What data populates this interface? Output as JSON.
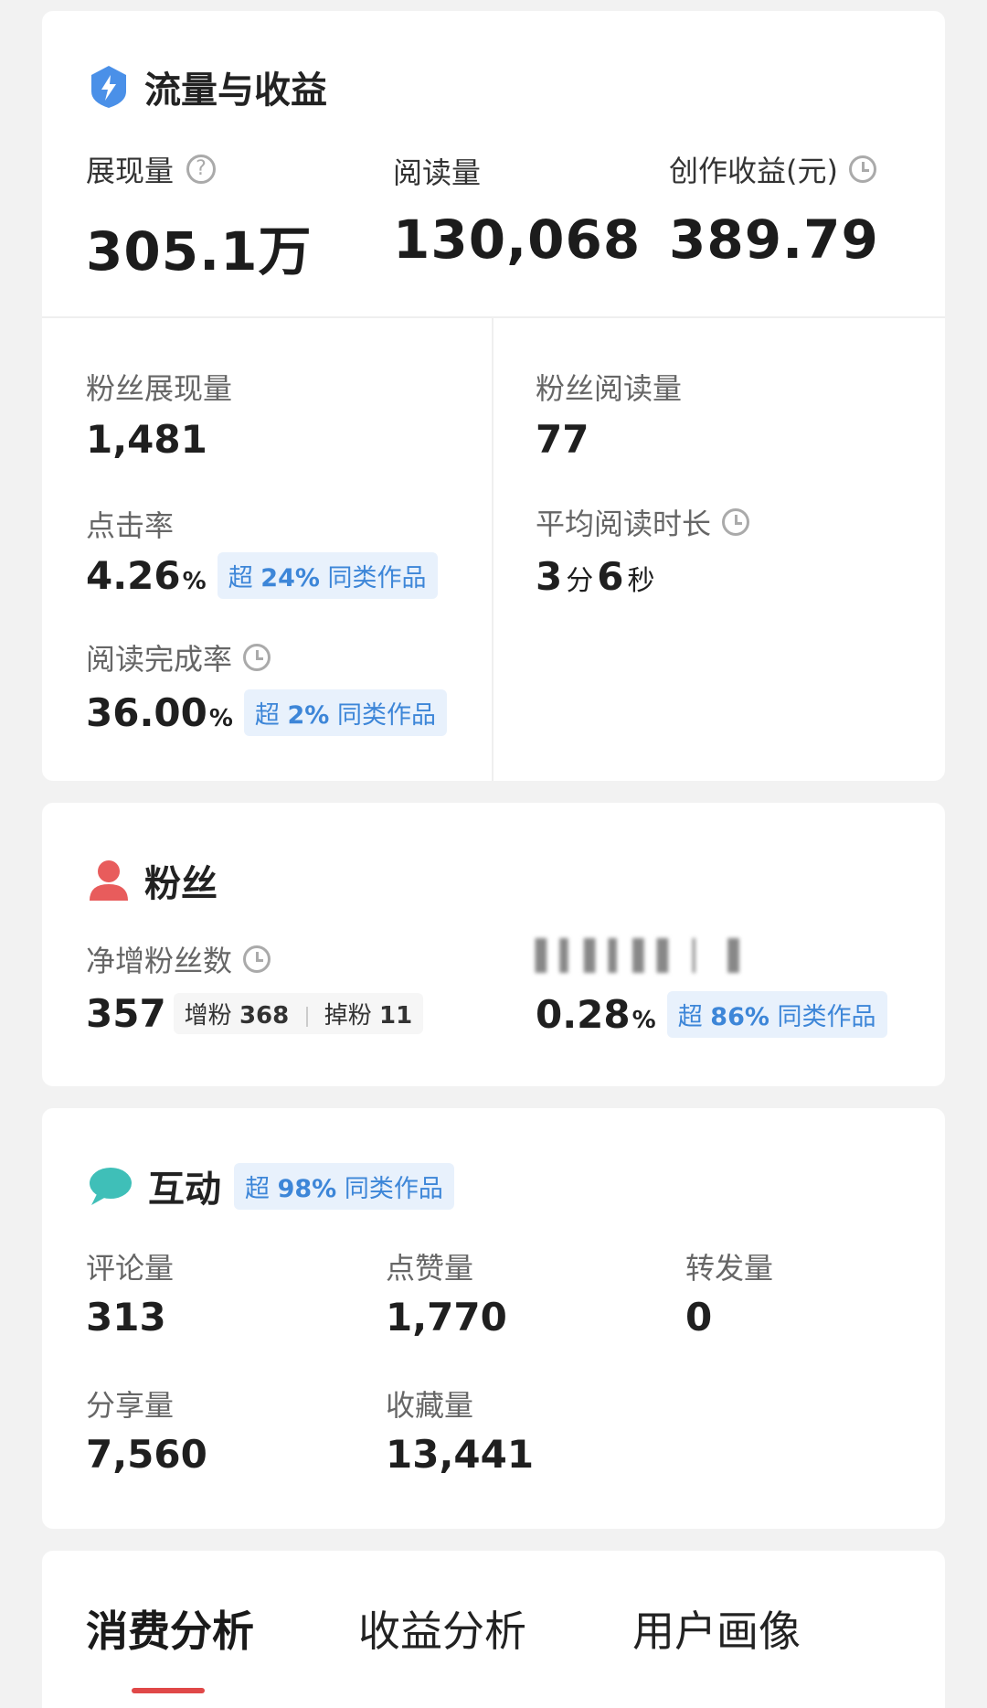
{
  "traffic": {
    "title": "流量与收益",
    "impressions": {
      "label": "展现量",
      "value": "305.1万"
    },
    "reads": {
      "label": "阅读量",
      "value": "130,068"
    },
    "earnings": {
      "label": "创作收益(元)",
      "value": "389.79"
    },
    "fan_impressions": {
      "label": "粉丝展现量",
      "value": "1,481"
    },
    "fan_reads": {
      "label": "粉丝阅读量",
      "value": "77"
    },
    "ctr": {
      "label": "点击率",
      "value": "4.26",
      "unit": "%",
      "badge_prefix": "超",
      "badge_value": "24%",
      "badge_suffix": "同类作品"
    },
    "avg_read_time": {
      "label": "平均阅读时长",
      "minutes": "3",
      "minutes_unit": "分",
      "seconds": "6",
      "seconds_unit": "秒"
    },
    "completion": {
      "label": "阅读完成率",
      "value": "36.00",
      "unit": "%",
      "badge_prefix": "超",
      "badge_value": "2%",
      "badge_suffix": "同类作品"
    }
  },
  "fans": {
    "title": "粉丝",
    "net_growth": {
      "label": "净增粉丝数",
      "value": "357",
      "gain_label": "增粉",
      "gain_value": "368",
      "loss_label": "掉粉",
      "loss_value": "11"
    },
    "conversion": {
      "value": "0.28",
      "unit": "%",
      "badge_prefix": "超",
      "badge_value": "86%",
      "badge_suffix": "同类作品"
    }
  },
  "interaction": {
    "title": "互动",
    "badge_prefix": "超",
    "badge_value": "98%",
    "badge_suffix": "同类作品",
    "comments": {
      "label": "评论量",
      "value": "313"
    },
    "likes": {
      "label": "点赞量",
      "value": "1,770"
    },
    "reposts": {
      "label": "转发量",
      "value": "0"
    },
    "shares": {
      "label": "分享量",
      "value": "7,560"
    },
    "favorites": {
      "label": "收藏量",
      "value": "13,441"
    }
  },
  "tabs": [
    {
      "label": "消费分析"
    },
    {
      "label": "收益分析"
    },
    {
      "label": "用户画像"
    }
  ],
  "colors": {
    "accent_blue": "#3d86d8",
    "fan_red": "#e85c5c",
    "chat_teal": "#3fbfb8",
    "tab_indicator": "#e04848"
  }
}
